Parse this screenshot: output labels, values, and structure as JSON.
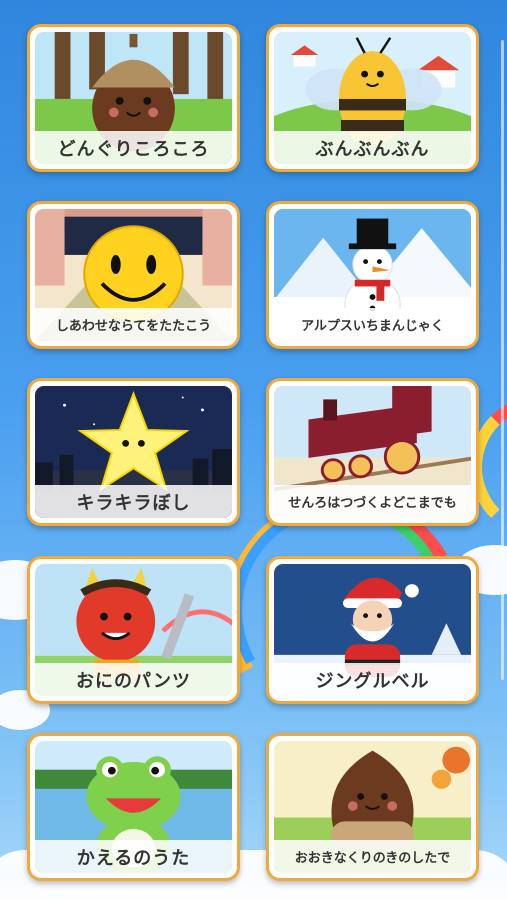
{
  "songs": [
    {
      "id": "donguri",
      "label": "どんぐりころころ"
    },
    {
      "id": "bunbunbun",
      "label": "ぶんぶんぶん"
    },
    {
      "id": "shiawase",
      "label": "しあわせならてをたたこう"
    },
    {
      "id": "alps",
      "label": "アルプスいちまんじゃく"
    },
    {
      "id": "kirakira",
      "label": "キラキラぼし"
    },
    {
      "id": "senro",
      "label": "せんろはつづくよどこまでも"
    },
    {
      "id": "oni",
      "label": "おにのパンツ"
    },
    {
      "id": "jinglebell",
      "label": "ジングルベル"
    },
    {
      "id": "kaeru",
      "label": "かえるのうた"
    },
    {
      "id": "ookinakuri",
      "label": "おおきなくりのきのしたで"
    }
  ],
  "colors": {
    "card_border": "#f2a93b",
    "background_top": "#2f86dc",
    "background_bottom": "#a8d8fa"
  }
}
